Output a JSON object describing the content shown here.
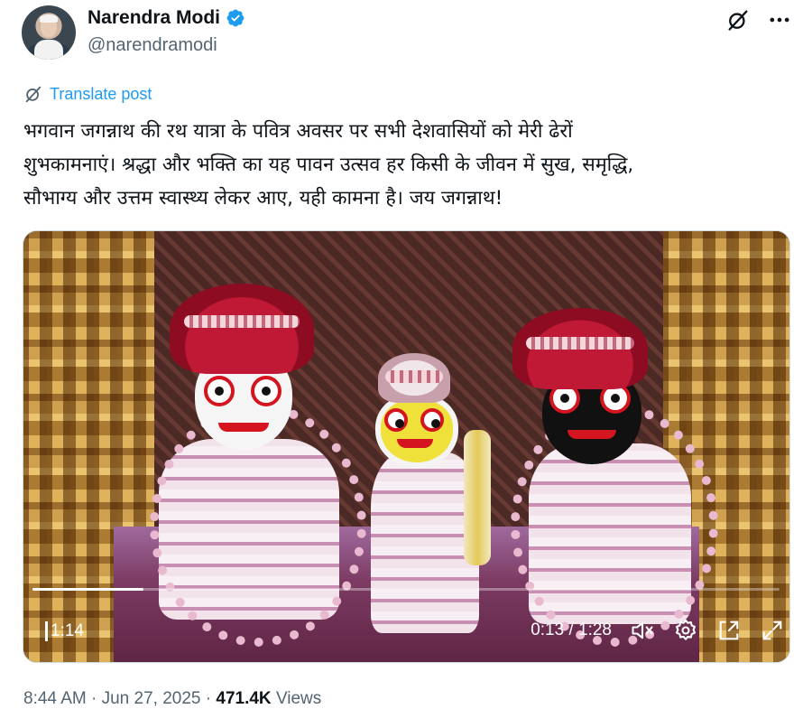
{
  "author": {
    "name": "Narendra Modi",
    "handle": "@narendramodi",
    "verified_color": "#1d9bf0"
  },
  "header_icons": [
    "grok-icon",
    "more-icon"
  ],
  "translate": {
    "label": "Translate post",
    "color": "#1d9bf0"
  },
  "post": {
    "lines": [
      "भगवान जगन्नाथ की रथ यात्रा के पवित्र अवसर पर सभी देशवासियों को मेरी ढेरों",
      "शुभकामनाएं। श्रद्धा और भक्ति का यह पावन उत्सव हर किसी के जीवन में सुख, समृद्धि,",
      "सौभाग्य और उत्तम स्वास्थ्य लेकर आए, यही कामना है। जय जगन्नाथ!"
    ]
  },
  "video": {
    "overlay_left": "1:14",
    "time_display": "0:13 / 1:28",
    "progress_fraction": 0.148,
    "controls": [
      "mute-icon",
      "settings-icon",
      "pip-icon",
      "fullscreen-icon"
    ]
  },
  "meta": {
    "time": "8:44 AM",
    "date": "Jun 27, 2025",
    "views_count": "471.4K",
    "views_label": "Views",
    "separator": "·"
  }
}
